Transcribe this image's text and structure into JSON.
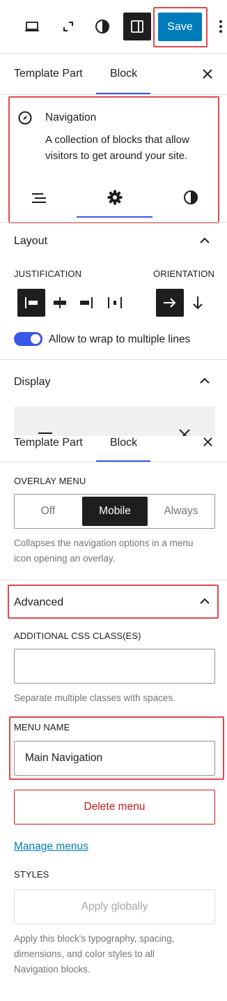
{
  "toolbar": {
    "save_label": "Save",
    "icons": [
      "desktop-icon",
      "fullscreen-icon",
      "contrast-icon",
      "sidebar-icon",
      "more-icon"
    ]
  },
  "tabs_top": {
    "template_part": "Template Part",
    "block": "Block"
  },
  "block_card": {
    "title": "Navigation",
    "description_line1": "A collection of blocks that allow",
    "description_line2": "visitors to get around your site."
  },
  "layout": {
    "title": "Layout",
    "justification_label": "JUSTIFICATION",
    "orientation_label": "ORIENTATION",
    "wrap_label": "Allow to wrap to multiple lines"
  },
  "display": {
    "title": "Display"
  },
  "tabs_second": {
    "template_part": "Template Part",
    "block": "Block"
  },
  "overlay": {
    "label": "OVERLAY MENU",
    "options": [
      "Off",
      "Mobile",
      "Always"
    ],
    "selected": "Mobile",
    "help_line1": "Collapses the navigation options in a menu",
    "help_line2": "icon opening an overlay."
  },
  "advanced": {
    "title": "Advanced",
    "css_label": "ADDITIONAL CSS CLASS(ES)",
    "css_value": "",
    "css_help": "Separate multiple classes with spaces.",
    "menu_name_label": "MENU NAME",
    "menu_name_value": "Main Navigation",
    "delete_label": "Delete menu",
    "manage_label": "Manage menus",
    "styles_label": "STYLES",
    "apply_label": "Apply globally",
    "apply_help_line1": "Apply this block's typography, spacing,",
    "apply_help_line2": "dimensions, and color styles to all",
    "apply_help_line3": "Navigation blocks."
  },
  "colors": {
    "accent": "#3858e9",
    "save_bg": "#007cba",
    "highlight": "#e0474c",
    "danger": "#cc1818"
  }
}
